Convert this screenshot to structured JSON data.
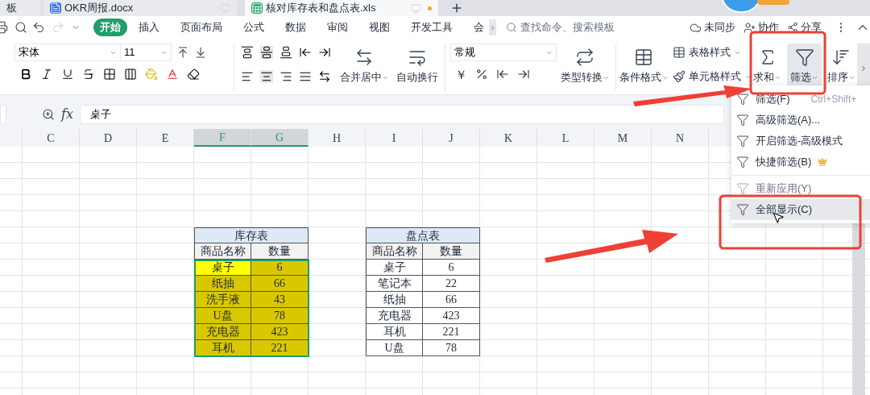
{
  "tabs": [
    {
      "label": "板",
      "kind": "plain",
      "selected": false
    },
    {
      "label": "OKR周报.docx",
      "kind": "doc",
      "selected": false
    },
    {
      "label": "核对库存表和盘点表.xls",
      "kind": "sheet",
      "selected": true
    }
  ],
  "menu": [
    {
      "label": "开始",
      "selected": true
    },
    {
      "label": "插入",
      "selected": false
    },
    {
      "label": "页面布局",
      "selected": false
    },
    {
      "label": "公式",
      "selected": false
    },
    {
      "label": "数据",
      "selected": false
    },
    {
      "label": "审阅",
      "selected": false
    },
    {
      "label": "视图",
      "selected": false
    },
    {
      "label": "开发工具",
      "selected": false
    },
    {
      "label": "会",
      "selected": false
    }
  ],
  "search": {
    "placeholder": "查找命令、搜索模板"
  },
  "actions": [
    "未同步",
    "协作",
    "分享"
  ],
  "ribbon": {
    "font_name": "宋体",
    "font_size": "11",
    "merge": "合并居中",
    "wrap": "自动换行",
    "number_format": "常规",
    "currency": "￥",
    "convert": "类型转换",
    "conditional": "条件格式",
    "table_style": "表格样式",
    "cell_style": "单元格样式",
    "sum": "求和",
    "filter": {
      "label": "筛选",
      "selected": true
    },
    "sort": "排序"
  },
  "formula_bar": {
    "fx": "fx",
    "value": "桌子"
  },
  "columns": [
    {
      "label": "C",
      "selected": false
    },
    {
      "label": "D",
      "selected": false
    },
    {
      "label": "E",
      "selected": false
    },
    {
      "label": "F",
      "selected": true
    },
    {
      "label": "G",
      "selected": true
    },
    {
      "label": "H",
      "selected": false
    },
    {
      "label": "I",
      "selected": false
    },
    {
      "label": "J",
      "selected": false
    },
    {
      "label": "K",
      "selected": false
    },
    {
      "label": "L",
      "selected": false
    },
    {
      "label": "M",
      "selected": false
    },
    {
      "label": "N",
      "selected": false
    }
  ],
  "tables": [
    {
      "title": "库存表",
      "headers": [
        "商品名称",
        "数量"
      ],
      "highlighted": true,
      "selected": true,
      "rows": [
        {
          "cells": [
            "桌子",
            "6"
          ],
          "active": true
        },
        {
          "cells": [
            "纸抽",
            "66"
          ],
          "active": false
        },
        {
          "cells": [
            "洗手液",
            "43"
          ],
          "active": false
        },
        {
          "cells": [
            "U盘",
            "78"
          ],
          "active": false
        },
        {
          "cells": [
            "充电器",
            "423"
          ],
          "active": false
        },
        {
          "cells": [
            "耳机",
            "221"
          ],
          "active": false
        }
      ]
    },
    {
      "title": "盘点表",
      "headers": [
        "商品名称",
        "数量"
      ],
      "highlighted": false,
      "selected": false,
      "rows": [
        {
          "cells": [
            "桌子",
            "6"
          ],
          "active": false
        },
        {
          "cells": [
            "笔记本",
            "22"
          ],
          "active": false
        },
        {
          "cells": [
            "纸抽",
            "66"
          ],
          "active": false
        },
        {
          "cells": [
            "充电器",
            "423"
          ],
          "active": false
        },
        {
          "cells": [
            "耳机",
            "221"
          ],
          "active": false
        },
        {
          "cells": [
            "U盘",
            "78"
          ],
          "active": false
        }
      ]
    }
  ],
  "filter_menu": [
    {
      "kind": "item",
      "label": "筛选(F)",
      "shortcut": "Ctrl+Shift+",
      "disabled": false,
      "hovered": false,
      "premium": false
    },
    {
      "kind": "item",
      "label": "高级筛选(A)...",
      "disabled": false,
      "hovered": false,
      "premium": false
    },
    {
      "kind": "item",
      "label": "开启筛选-高级模式",
      "disabled": false,
      "hovered": false,
      "premium": false
    },
    {
      "kind": "item",
      "label": "快捷筛选(B)",
      "disabled": false,
      "hovered": false,
      "premium": true
    },
    {
      "kind": "separator"
    },
    {
      "kind": "item",
      "label": "重新应用(Y)",
      "disabled": true,
      "hovered": false,
      "premium": false
    },
    {
      "kind": "item",
      "label": "全部显示(C)",
      "disabled": false,
      "hovered": true,
      "premium": false
    }
  ]
}
